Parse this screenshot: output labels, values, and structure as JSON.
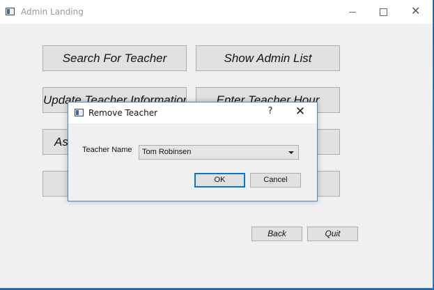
{
  "main_window": {
    "title": "Admin Landing",
    "minimize_glyph": "—",
    "close_glyph": "✕"
  },
  "buttons": {
    "search_teacher": "Search For Teacher",
    "show_admin_list": "Show Admin List",
    "update_teacher_info": "Update Teacher Information",
    "enter_teacher_hour": "Enter Teacher Hour",
    "as_partial": "As",
    "back": "Back",
    "quit": "Quit"
  },
  "dialog": {
    "title": "Remove Teacher",
    "help_glyph": "?",
    "close_glyph": "✕",
    "teacher_name_label": "Teacher Name",
    "teacher_name_value": "Tom Robinsen",
    "ok_label": "OK",
    "cancel_label": "Cancel"
  },
  "colors": {
    "accent": "#0078d7",
    "window_bg": "#f0f0f0",
    "desktop": "#0e5db8"
  },
  "icons": {
    "app": "app-window-icon",
    "dropdown": "chevron-down-icon"
  }
}
